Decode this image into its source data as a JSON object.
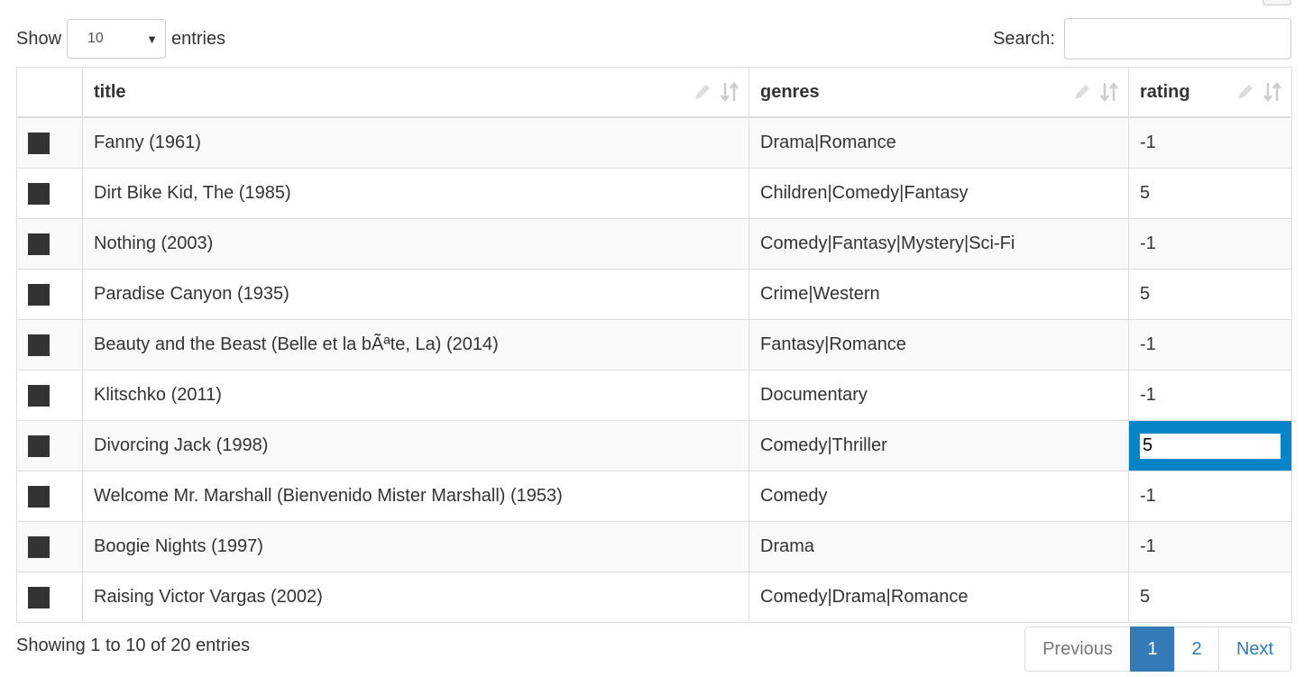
{
  "length_menu": {
    "show_label": "Show",
    "selected": "10",
    "entries_label": "entries"
  },
  "search": {
    "label": "Search:",
    "value": "",
    "placeholder": ""
  },
  "table": {
    "columns": [
      "",
      "title",
      "genres",
      "rating"
    ],
    "rows": [
      {
        "title": "Fanny (1961)",
        "genres": "Drama|Romance",
        "rating": "-1"
      },
      {
        "title": "Dirt Bike Kid, The (1985)",
        "genres": "Children|Comedy|Fantasy",
        "rating": "5"
      },
      {
        "title": "Nothing (2003)",
        "genres": "Comedy|Fantasy|Mystery|Sci-Fi",
        "rating": "-1"
      },
      {
        "title": "Paradise Canyon (1935)",
        "genres": "Crime|Western",
        "rating": "5"
      },
      {
        "title": "Beauty and the Beast (Belle et la bÃªte, La) (2014)",
        "genres": "Fantasy|Romance",
        "rating": "-1"
      },
      {
        "title": "Klitschko (2011)",
        "genres": "Documentary",
        "rating": "-1"
      },
      {
        "title": "Divorcing Jack (1998)",
        "genres": "Comedy|Thriller",
        "rating": "5"
      },
      {
        "title": "Welcome Mr. Marshall (Bienvenido Mister Marshall) (1953)",
        "genres": "Comedy",
        "rating": "-1"
      },
      {
        "title": "Boogie Nights (1997)",
        "genres": "Drama",
        "rating": "-1"
      },
      {
        "title": "Raising Victor Vargas (2002)",
        "genres": "Comedy|Drama|Romance",
        "rating": "5"
      }
    ]
  },
  "info": "Showing 1 to 10 of 20 entries",
  "pagination": {
    "previous": "Previous",
    "pages": [
      "1",
      "2"
    ],
    "current": "1",
    "next": "Next"
  },
  "colors": {
    "accent": "#337ab7",
    "active_cell": "#0584c7",
    "selector": "#333333"
  }
}
